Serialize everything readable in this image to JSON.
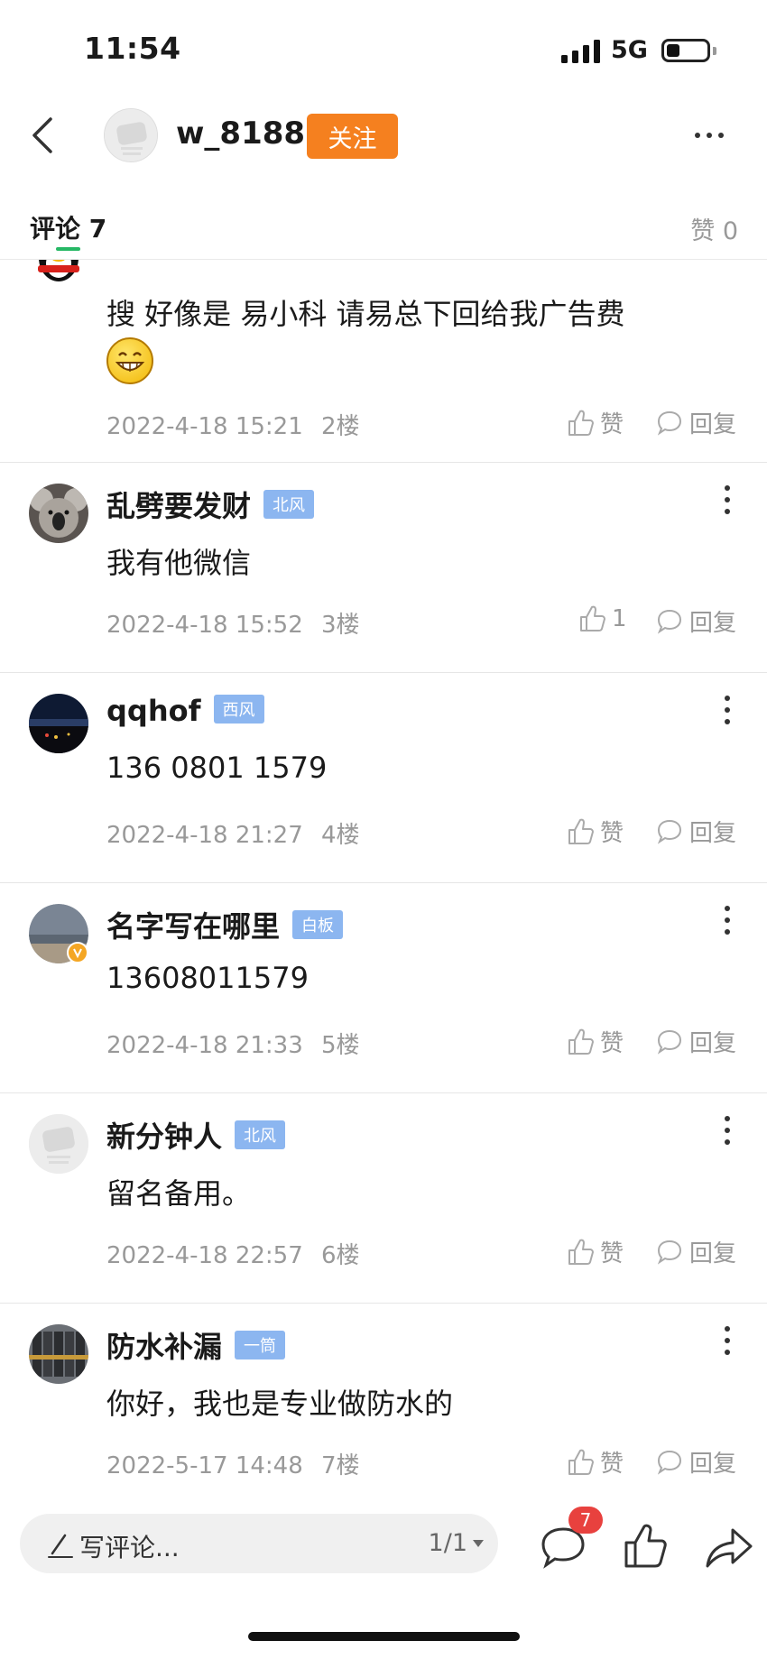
{
  "status_bar": {
    "time": "11:54",
    "network": "5G"
  },
  "header": {
    "username": "w_8188",
    "follow_label": "关注"
  },
  "tabs": {
    "comments_label": "评论",
    "comments_count": "7",
    "likes_label": "赞",
    "likes_count": "0"
  },
  "comments": [
    {
      "text": "搜 好像是  易小科  请易总下回给我广告费",
      "date": "2022-4-18 15:21",
      "floor": "2楼",
      "like_label": "赞",
      "reply_label": "回复"
    },
    {
      "name": "乱劈要发财",
      "badge": "北风",
      "text": "我有他微信",
      "date": "2022-4-18 15:52",
      "floor": "3楼",
      "like_label": "1",
      "reply_label": "回复"
    },
    {
      "name": "qqhof",
      "badge": "西风",
      "text": "136 0801 1579",
      "date": "2022-4-18 21:27",
      "floor": "4楼",
      "like_label": "赞",
      "reply_label": "回复"
    },
    {
      "name": "名字写在哪里",
      "badge": "白板",
      "text": "13608011579",
      "date": "2022-4-18 21:33",
      "floor": "5楼",
      "like_label": "赞",
      "reply_label": "回复"
    },
    {
      "name": "新分钟人",
      "badge": "北风",
      "text": "留名备用。",
      "date": "2022-4-18 22:57",
      "floor": "6楼",
      "like_label": "赞",
      "reply_label": "回复"
    },
    {
      "name": "防水补漏",
      "badge": "一筒",
      "text": "你好，我也是专业做防水的",
      "date": "2022-5-17 14:48",
      "floor": "7楼",
      "like_label": "赞",
      "reply_label": "回复"
    }
  ],
  "bottom_bar": {
    "write_placeholder": "写评论...",
    "page_indicator": "1/1",
    "comment_badge": "7"
  },
  "colors": {
    "accent": "#f5801f",
    "badge": "#8cb6f0",
    "tab_underline": "#26b865",
    "notification": "#e8413e"
  },
  "icons": [
    "back-icon",
    "more-icon",
    "like-icon",
    "reply-icon",
    "pen-icon",
    "comment-icon",
    "thumbs-up-icon",
    "share-icon",
    "grin-emoji-icon"
  ]
}
